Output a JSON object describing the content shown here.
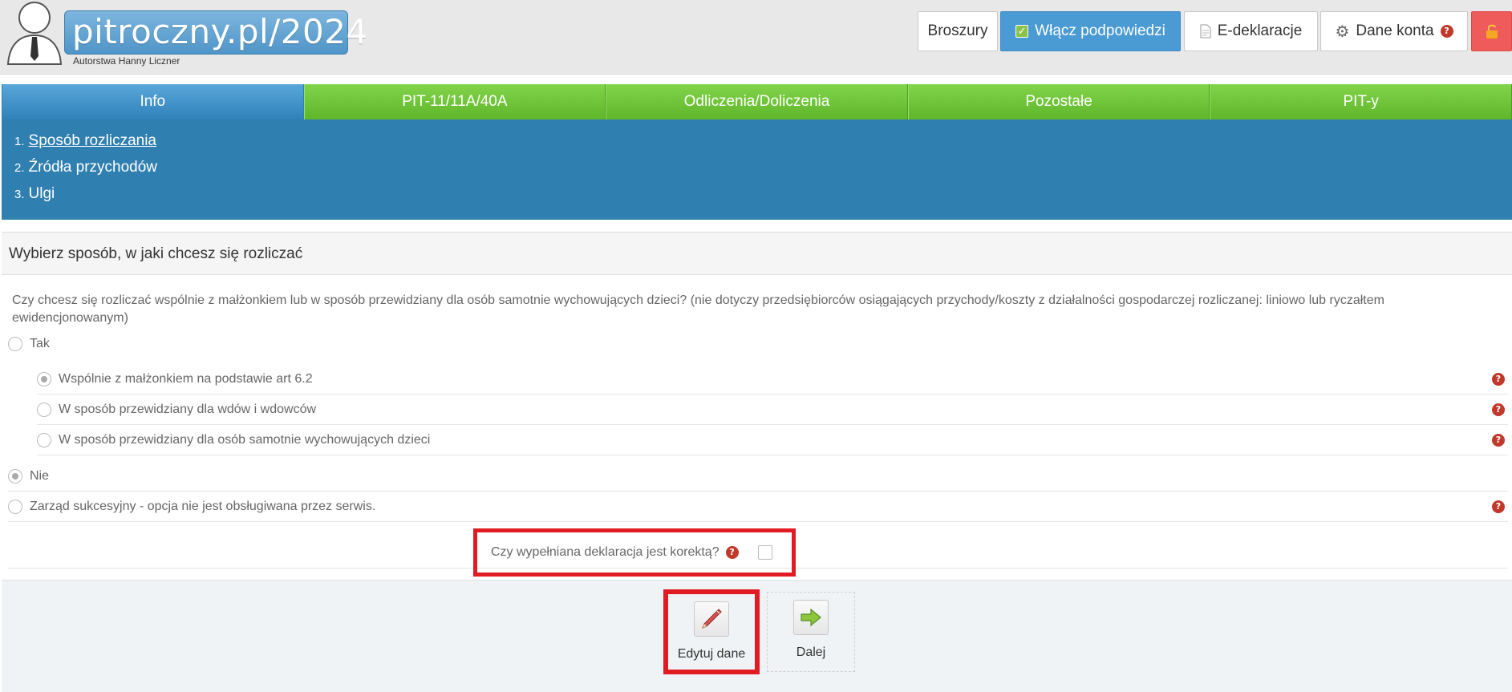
{
  "header": {
    "logo_text": "pitroczny.pl/2024",
    "logo_subtitle": "Autorstwa Hanny Liczner",
    "buttons": {
      "broszury": "Broszury",
      "hints": "Włącz podpowiedzi",
      "edeklaracje": "E-deklaracje",
      "konto": "Dane konta"
    }
  },
  "tabs": [
    {
      "label": "Info",
      "active": true
    },
    {
      "label": "PIT-11/11A/40A"
    },
    {
      "label": "Odliczenia/Doliczenia"
    },
    {
      "label": "Pozostałe"
    },
    {
      "label": "PIT-y"
    }
  ],
  "steps": [
    {
      "num": "1.",
      "label": "Sposób rozliczania"
    },
    {
      "num": "2.",
      "label": "Źródła przychodów"
    },
    {
      "num": "3.",
      "label": "Ulgi"
    }
  ],
  "section": {
    "title": "Wybierz sposób, w jaki chcesz się rozliczać",
    "question": "Czy chcesz się rozliczać wspólnie z małżonkiem lub w sposób przewidziany dla osób samotnie wychowujących dzieci? (nie dotyczy przedsiębiorców osiągających przychody/koszty z działalności gospodarczej rozliczanej: liniowo lub ryczałtem ewidencjonowanym)",
    "options": {
      "tak": "Tak",
      "wspolnie": "Wspólnie z małżonkiem na podstawie art 6.2",
      "wdowy": "W sposób przewidziany dla wdów i wdowców",
      "samotnie": "W sposób przewidziany dla osób samotnie wychowujących dzieci",
      "nie": "Nie",
      "zarzad": "Zarząd sukcesyjny - opcja nie jest obsługiwana przez serwis."
    },
    "korekta_label": "Czy wypełniana deklaracja jest korektą?"
  },
  "actions": {
    "edit": "Edytuj dane",
    "next": "Dalej"
  }
}
